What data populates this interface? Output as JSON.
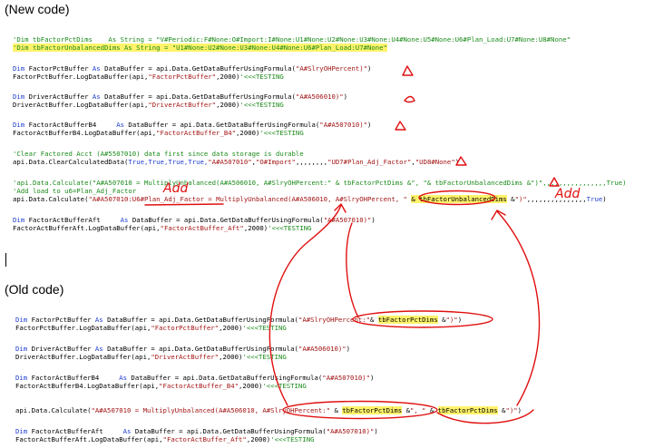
{
  "headings": {
    "new_code": "(New code)",
    "old_code": "(Old code)"
  },
  "annotations": {
    "add_1": "Add",
    "add_2": "Add"
  },
  "colors": {
    "keyword": "#1f3dd1",
    "comment": "#1a8a1a",
    "string": "#a31515",
    "highlight": "#fff36a",
    "annotation": "#e01010"
  },
  "new_code": {
    "l1_comment": "'Dim tbFactorPctDims    As String = \"V#Periodic:F#None:O#Import:I#None:U1#None:U2#None:U3#None:U4#None:U5#None:U6#Plan_Load:U7#None:U8#None\"",
    "l2_comment": "'Dim tbFactorUnbalancedDims As String = \"U1#None:U2#None:U3#None:U4#None:U6#Plan_Load:U7#None\"",
    "l3_kw1": "Dim",
    "l3_a": " FactorPctBuffer ",
    "l3_kw2": "As",
    "l3_b": " DataBuffer = api.Data.GetDataBufferUsingFormula(",
    "l3_str": "\"A#SlryOHPercent)\"",
    "l3_c": ")",
    "l4_a": "FactorPctBuffer.LogDataBuffer(api,",
    "l4_str": "\"FactorPctBuffer\"",
    "l4_b": ",2000)",
    "l4_cm": "'<<<TESTING",
    "l5_kw1": "Dim",
    "l5_a": " DriverActBuffer ",
    "l5_kw2": "As",
    "l5_b": " DataBuffer = api.Data.GetDataBufferUsingFormula(",
    "l5_str": "\"A#A506010)\"",
    "l5_c": ")",
    "l6_a": "DriverActBuffer.LogDataBuffer(api,",
    "l6_str": "\"DriverActBuffer\"",
    "l6_b": ",2000)",
    "l6_cm": "'<<<TESTING",
    "l7_kw1": "Dim",
    "l7_a": " FactorActBufferB4     ",
    "l7_kw2": "As",
    "l7_b": " DataBuffer = api.Data.GetDataBufferUsingFormula(",
    "l7_str": "\"A#A507010)\"",
    "l7_c": ")",
    "l8_a": "FactorActBufferB4.LogDataBuffer(api,",
    "l8_str": "\"FactorActBuffer_B4\"",
    "l8_b": ",2000)",
    "l8_cm": "'<<<TESTING",
    "l9_comment": "'Clear Factored Acct (A#5507010) data first since data storage is durable",
    "l10_a": "api.Data.ClearCalculatedData(",
    "l10_kw": "True,True,True,True,",
    "l10_str1": "\"A#A507010\"",
    "l10_b": ",",
    "l10_str2": "\"O#Import\"",
    "l10_c": ",,,,,,,,",
    "l10_str3": "\"UD7#Plan_Adj_Factor\"",
    "l10_d": ",",
    "l10_str4": "\"UD8#None\"",
    "l10_e": ")",
    "l11_comment": "'api.Data.Calculate(\"A#A507010 = MultiplyUnbalanced(A#A506010, A#SlryOHPercent:\" & tbFactorPctDims &\", \"& tbFactorUnbalancedDims &\")\",,,,,,,,,,,,,,,,True)",
    "l12_comment": "'Add load to u6=Plan_Adj_Factor",
    "l13_a": "api.Data.Calculate(",
    "l13_str1": "\"A#A507010:U6#Plan_Adj_Factor = MultiplyUnbalanced(A#A506010, A#SlryOHPercent, \"",
    "l13_b": " ",
    "l13_hl": "& tbFactorUnbalancedDims",
    "l13_c": " &",
    "l13_str2": "\")\"",
    "l13_d": ",,,,,,,,,,,,,,,",
    "l13_kw": "True",
    "l13_e": ")",
    "l14_kw1": "Dim",
    "l14_a": " FactorActBufferAft     ",
    "l14_kw2": "As",
    "l14_b": " DataBuffer = api.Data.GetDataBufferUsingFormula(",
    "l14_str": "\"A#A507010)\"",
    "l14_c": ")",
    "l15_a": "FactorActBufferAft.LogDataBuffer(api,",
    "l15_str": "\"FactorActBuffer_Aft\"",
    "l15_b": ",2000)",
    "l15_cm": "'<<<TESTING"
  },
  "old_code": {
    "l1_kw1": "Dim",
    "l1_a": " FactorPctBuffer ",
    "l1_kw2": "As",
    "l1_b": " DataBuffer = api.Data.GetDataBufferUsingFormula(",
    "l1_str": "\"A#SlryOHPercent:\"",
    "l1_c": "& ",
    "l1_hl": "tbFactorPctDims",
    "l1_d": " &",
    "l1_str2": "\")\"",
    "l1_e": ")",
    "l2_a": "FactorPctBuffer.LogDataBuffer(api,",
    "l2_str": "\"FactorPctBuffer\"",
    "l2_b": ",2000)",
    "l2_cm": "'<<<TESTING",
    "l3_kw1": "Dim",
    "l3_a": " DriverActBuffer ",
    "l3_kw2": "As",
    "l3_b": " DataBuffer = api.Data.GetDataBufferUsingFormula(",
    "l3_str": "\"A#A506010)\"",
    "l3_c": ")",
    "l4_a": "DriverActBuffer.LogDataBuffer(api,",
    "l4_str": "\"DriverActBuffer\"",
    "l4_b": ",2000)",
    "l4_cm": "'<<<TESTING",
    "l5_kw1": "Dim",
    "l5_a": " FactorActBufferB4     ",
    "l5_kw2": "As",
    "l5_b": " DataBuffer = api.Data.GetDataBufferUsingFormula(",
    "l5_str": "\"A#A507010)\"",
    "l5_c": ")",
    "l6_a": "FactorActBufferB4.LogDataBuffer(api,",
    "l6_str": "\"FactorActBuffer_B4\"",
    "l6_b": ",2000)",
    "l6_cm": "'<<<TESTING",
    "l7_a": "api.Data.Calculate(",
    "l7_str1": "\"A#A507010 = MultiplyUnbalanced(A#A506010, A#SlryOHPercent:\"",
    "l7_b": " & ",
    "l7_hl1": "tbFactorPctDims",
    "l7_c": " &",
    "l7_str2": "\", \"",
    "l7_d": " & ",
    "l7_hl2": "tbFactorPctDims",
    "l7_e": " &",
    "l7_str3": "\")\"",
    "l7_f": ")",
    "l8_kw1": "Dim",
    "l8_a": " FactorActBufferAft     ",
    "l8_kw2": "As",
    "l8_b": " DataBuffer = api.Data.GetDataBufferUsingFormula(",
    "l8_str": "\"A#A507010)\"",
    "l8_c": ")",
    "l9_a": "FactorActBufferAft.LogDataBuffer(api,",
    "l9_str": "\"FactorActBuffer_Aft\"",
    "l9_b": ",2000)",
    "l9_cm": "'<<<TESTING"
  }
}
